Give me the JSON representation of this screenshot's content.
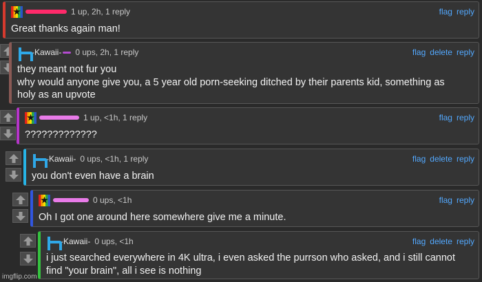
{
  "colors": {
    "link": "#53a9ff",
    "bar_red": "#d63a2e",
    "bar_brown": "#8a5a55",
    "bar_purple": "#b536c9",
    "bar_cyan": "#27b4e6",
    "bar_blue": "#3156e0",
    "bar_green": "#35c23f",
    "scribble_pink": "#e87be8",
    "scribble_red": "#ff2a6a"
  },
  "icons": {
    "upvote": "arrow-up-icon",
    "downvote": "arrow-down-icon",
    "avatar_star": "rainbow-star-avatar",
    "avatar_h": "h-letter-avatar"
  },
  "comments": [
    {
      "meta": "1 up, 2h, 1 reply",
      "actions": [
        "flag",
        "reply"
      ],
      "text": [
        "Great thanks again man!"
      ]
    },
    {
      "user": "-Kawaii-",
      "meta": "0 ups, 2h, 1 reply",
      "actions": [
        "flag",
        "delete",
        "reply"
      ],
      "text": [
        "they meant not fur you",
        "why would anyone give you, a 5 year old porn-seeking ditched by their parents kid, something as",
        "holy as an upvote"
      ]
    },
    {
      "meta": "1 up, <1h, 1 reply",
      "actions": [
        "flag",
        "reply"
      ],
      "text": [
        "?????????????"
      ]
    },
    {
      "user": "-Kawaii-",
      "meta": "0 ups, <1h, 1 reply",
      "actions": [
        "flag",
        "delete",
        "reply"
      ],
      "text": [
        "you don't even have a brain"
      ]
    },
    {
      "meta": "0 ups, <1h",
      "actions": [
        "flag",
        "reply"
      ],
      "text": [
        "Oh I got one around here somewhere give me a minute."
      ]
    },
    {
      "user": "-Kawaii-",
      "meta": "0 ups, <1h",
      "actions": [
        "flag",
        "delete",
        "reply"
      ],
      "text": [
        "i just searched everywhere in 4K ultra, i even asked the purrson who asked, and i still cannot",
        "find \"your brain\", all i see is nothing"
      ]
    }
  ],
  "watermark": "imgflip.com"
}
